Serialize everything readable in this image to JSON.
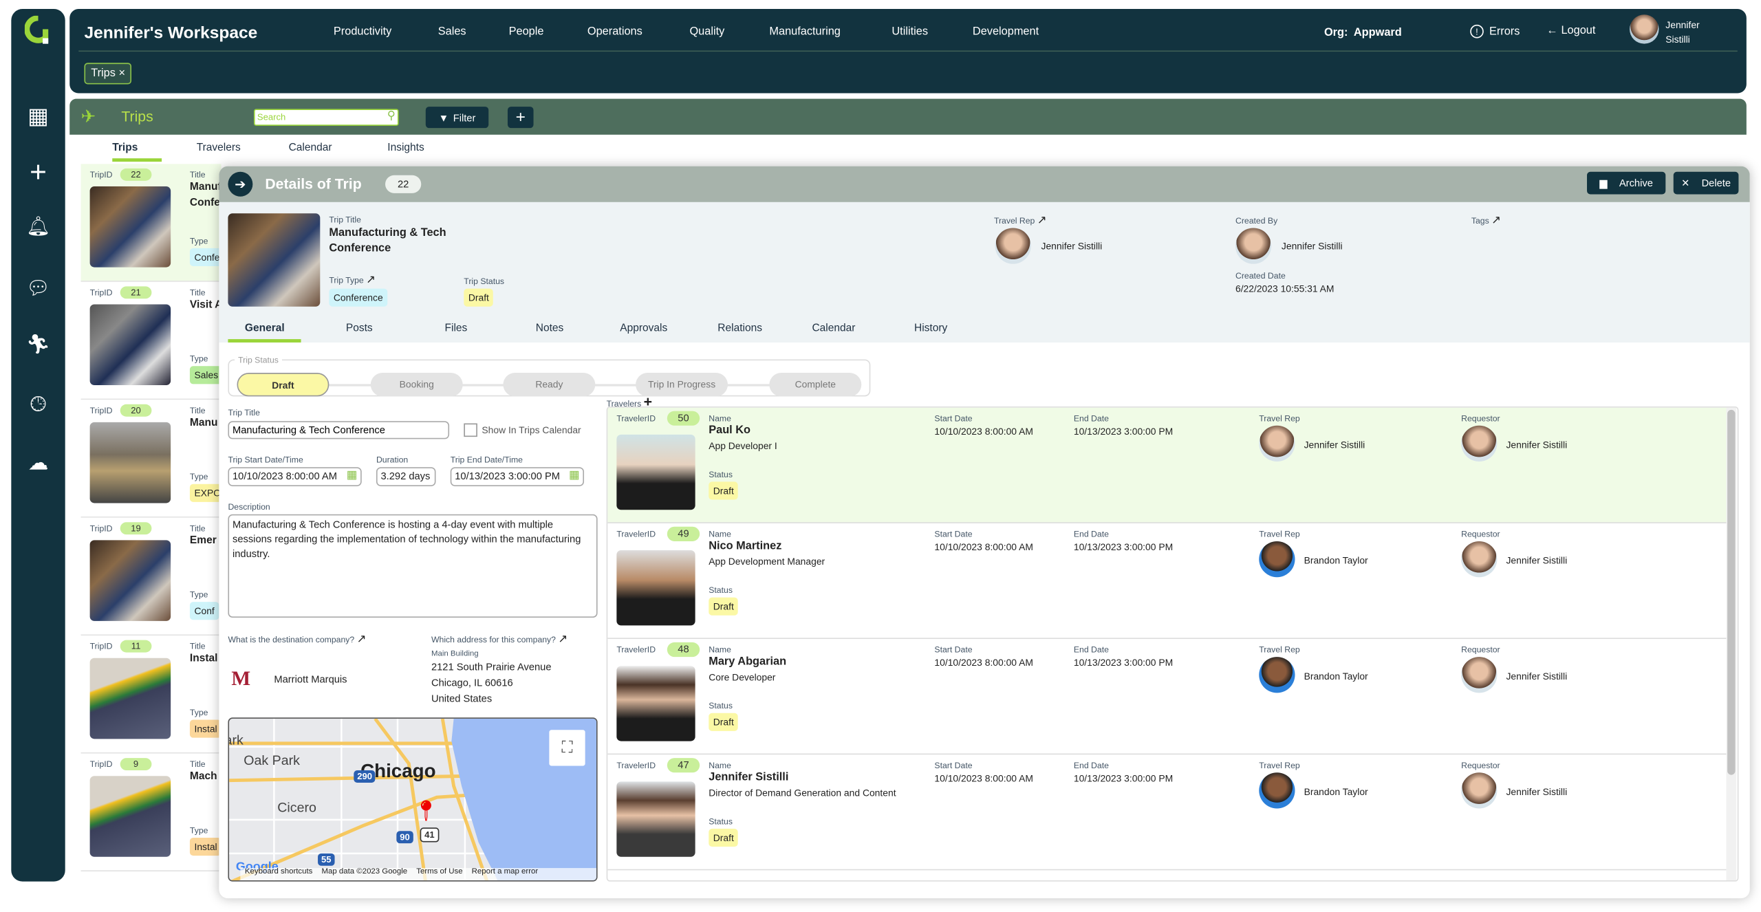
{
  "header": {
    "workspace": "Jennifer's Workspace",
    "nav": [
      "Productivity",
      "Sales",
      "People",
      "Operations",
      "Quality",
      "Manufacturing",
      "Utilities",
      "Development"
    ],
    "org_label": "Org:",
    "org": "Appward",
    "errors": "Errors",
    "logout": "Logout",
    "user_first": "Jennifer",
    "user_last": "Sistilli",
    "open_tab": "Trips",
    "tab_close": "×"
  },
  "sidebar": {
    "icons": [
      "app-logo",
      "grid-icon",
      "plus-icon",
      "bell-icon",
      "chat-icon",
      "runner-icon",
      "clock-icon",
      "cloud-upload-icon"
    ]
  },
  "module": {
    "title": "Trips",
    "search_placeholder": "Search",
    "filter": "Filter",
    "add": "+",
    "tabs": [
      "Trips",
      "Travelers",
      "Calendar",
      "Insights"
    ],
    "active_tab": "Trips"
  },
  "trips": [
    {
      "id": "22",
      "title": "Manufacturing & Tech Conference",
      "type": "Conference",
      "type_color": "#cff4fa",
      "photo": "conference"
    },
    {
      "id": "21",
      "title": "Visit A",
      "type": "Sales",
      "type_color": "#b6eb9a",
      "photo": "business"
    },
    {
      "id": "20",
      "title": "Manu",
      "type": "EXPO",
      "type_color": "#fbf3a0",
      "photo": "expo"
    },
    {
      "id": "19",
      "title": "Emer Conf",
      "type": "Conf",
      "type_color": "#cff4fa",
      "photo": "conference"
    },
    {
      "id": "11",
      "title": "Instal",
      "type": "Instal",
      "type_color": "#fcd79a",
      "photo": "solar"
    },
    {
      "id": "9",
      "title": "Mach Trip t",
      "type": "Instal",
      "type_color": "#fcd79a",
      "photo": "solar"
    }
  ],
  "trip_labels": {
    "id": "TripID",
    "title": "Title",
    "type": "Type"
  },
  "details": {
    "header": "Details of Trip",
    "id": "22",
    "archive": "Archive",
    "delete": "Delete",
    "trip_title_label": "Trip Title",
    "trip_title": "Manufacturing & Tech Conference",
    "trip_type_label": "Trip Type",
    "trip_type": "Conference",
    "trip_status_label": "Trip Status",
    "trip_status": "Draft",
    "travel_rep_label": "Travel Rep",
    "travel_rep": "Jennifer Sistilli",
    "created_by_label": "Created By",
    "created_by": "Jennifer Sistilli",
    "created_date_label": "Created Date",
    "created_date": "6/22/2023 10:55:31 AM",
    "tags_label": "Tags",
    "tabs": [
      "General",
      "Posts",
      "Files",
      "Notes",
      "Approvals",
      "Relations",
      "Calendar",
      "History"
    ],
    "active_tab": "General",
    "status_steps": [
      "Draft",
      "Booking",
      "Ready",
      "Trip In Progress",
      "Complete"
    ],
    "current_step": "Draft",
    "form": {
      "title_label": "Trip Title",
      "title": "Manufacturing & Tech Conference",
      "show_cal": "Show In Trips Calendar",
      "show_cal_checked": false,
      "start_label": "Trip Start Date/Time",
      "start": "10/10/2023 8:00:00 AM",
      "duration_label": "Duration",
      "duration": "3.292 days",
      "end_label": "Trip End Date/Time",
      "end": "10/13/2023 3:00:00 PM",
      "desc_label": "Description",
      "desc": "Manufacturing & Tech Conference is hosting a 4-day event with multiple sessions regarding the implementation of technology within the manufacturing industry.",
      "company_label": "What is the destination company?",
      "company": "Marriott Marquis",
      "company_logo": "MARRIOTT",
      "address_label": "Which address for this company?",
      "address_name": "Main Building",
      "address1": "2121 South Prairie Avenue",
      "address2": "Chicago, IL 60616",
      "address3": "United States"
    },
    "map": {
      "city": "Chicago",
      "labels": [
        "Park",
        "Oak Park",
        "Cicero"
      ],
      "shields": [
        "290",
        "90",
        "55",
        "41"
      ],
      "google": "Google",
      "footer": [
        "Keyboard shortcuts",
        "Map data ©2023 Google",
        "Terms of Use",
        "Report a map error"
      ]
    },
    "travelers_label": "Travelers",
    "traveler_labels": {
      "id": "TravelerID",
      "name": "Name",
      "start": "Start Date",
      "end": "End Date",
      "rep": "Travel Rep",
      "req": "Requestor",
      "status": "Status"
    },
    "travelers": [
      {
        "id": "50",
        "name": "Paul Ko",
        "role": "App Developer I",
        "start": "10/10/2023 8:00:00 AM",
        "end": "10/13/2023 3:00:00 PM",
        "rep": "Jennifer Sistilli",
        "req": "Jennifer Sistilli",
        "status": "Draft",
        "selected": true
      },
      {
        "id": "49",
        "name": "Nico Martinez",
        "role": "App Development Manager",
        "start": "10/10/2023 8:00:00 AM",
        "end": "10/13/2023 3:00:00 PM",
        "rep": "Brandon Taylor",
        "req": "Jennifer Sistilli",
        "status": "Draft"
      },
      {
        "id": "48",
        "name": "Mary Abgarian",
        "role": "Core Developer",
        "start": "10/10/2023 8:00:00 AM",
        "end": "10/13/2023 3:00:00 PM",
        "rep": "Brandon Taylor",
        "req": "Jennifer Sistilli",
        "status": "Draft"
      },
      {
        "id": "47",
        "name": "Jennifer Sistilli",
        "role": "Director of Demand Generation and Content",
        "start": "10/10/2023 8:00:00 AM",
        "end": "10/13/2023 3:00:00 PM",
        "rep": "Brandon Taylor",
        "req": "Jennifer Sistilli",
        "status": "Draft"
      }
    ]
  },
  "colors": {
    "dark": "#12333f",
    "module_bar": "#4e6e5d",
    "accent": "#8bc34a",
    "draft": "#fbf8a5",
    "badge": "#c9ef9a",
    "selected_row": "#f0fbe6"
  }
}
